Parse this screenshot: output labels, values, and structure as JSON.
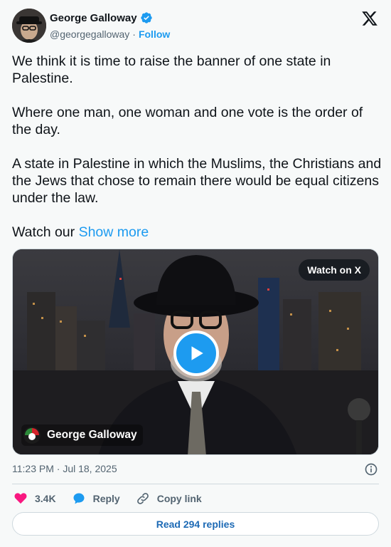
{
  "author": {
    "name": "George Galloway",
    "handle": "@georgegalloway",
    "separator": "·",
    "follow_label": "Follow",
    "verified_icon": "verified-badge-icon",
    "verified_color": "#1d9bf0"
  },
  "platform_icon": "x-logo-icon",
  "tweet": {
    "paragraphs": [
      "We think it is time to raise the banner of one state in Palestine.",
      "Where one man, one woman and one vote is the order of the day.",
      "A state in Palestine in which the Muslims, the Christians and the Jews that chose to remain there would be equal citizens under the law."
    ],
    "last_line_prefix": "Watch our ",
    "show_more_label": "Show more"
  },
  "media": {
    "watch_label": "Watch on X",
    "play_icon": "play-icon",
    "caption": "George Galloway"
  },
  "timestamp": "11:23 PM · Jul 18, 2025",
  "actions": {
    "likes": "3.4K",
    "reply_label": "Reply",
    "copy_link_label": "Copy link"
  },
  "read_replies_label": "Read 294 replies",
  "colors": {
    "accent": "#1d9bf0",
    "like": "#f91880",
    "muted": "#536471"
  }
}
